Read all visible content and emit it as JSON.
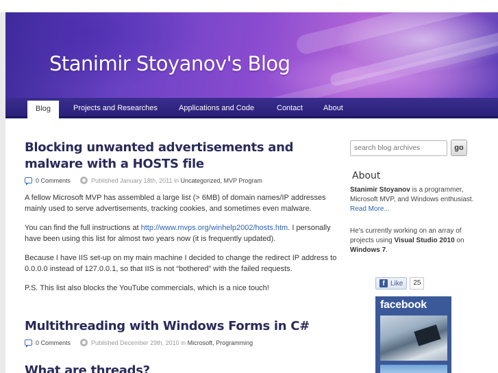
{
  "blog": {
    "title": "Stanimir Stoyanov's Blog"
  },
  "nav": {
    "items": [
      {
        "label": "Blog",
        "active": true
      },
      {
        "label": "Projects and Researches"
      },
      {
        "label": "Applications and Code"
      },
      {
        "label": "Contact"
      },
      {
        "label": "About"
      }
    ]
  },
  "posts": [
    {
      "title": "Blocking unwanted advertisements and malware with a HOSTS file",
      "comments": "0 Comments",
      "published": "Published January 18th, 2011 in",
      "categories": "Uncategorized, MVP Program",
      "paragraphs": [
        "A fellow Microsoft MVP has assembled a large list (> 6MB) of domain names/IP addresses mainly used to serve advertisements, tracking cookies, and sometimes even malware.",
        "Because I have IIS set-up on my main machine I decided to change the redirect IP address to 0.0.0.0 instead of 127.0.0.1, so that IIS is not “bothered” with the failed requests.",
        "P.S. This list also blocks the YouTube commercials, which is a nice touch!"
      ],
      "link_para": {
        "before": "You can find the full instructions  at ",
        "link": "http://www.mvps.org/winhelp2002/hosts.htm",
        "after": ". I personally have been using this list for almost two years now (it is frequently updated)."
      }
    },
    {
      "title": "Multithreading with Windows Forms in C#",
      "comments": "0 Comments",
      "published": "Published December 29th, 2010 in",
      "categories": "Microsoft, Programming",
      "subheading": "What are threads?"
    }
  ],
  "sidebar": {
    "search_placeholder": "search blog archives",
    "go_label": "go",
    "about_heading": "About",
    "about_name": "Stanimir Stoyanov",
    "about_text": " is a programmer, Microsoft MVP, and Windows enthusiast.",
    "read_more": "Read More...",
    "working_before": "He's currently working on an array of projects using ",
    "working_bold1": "Visual Studio 2010",
    "working_mid": " on ",
    "working_bold2": "Windows 7",
    "working_after": ".",
    "facebook": {
      "like_label": "Like",
      "like_count": "25",
      "logo_text": "facebook",
      "icon": "facebook-f-icon"
    }
  },
  "colors": {
    "accent": "#2c62b0",
    "nav_bg": "#2a1f78",
    "facebook": "#3b5998"
  }
}
